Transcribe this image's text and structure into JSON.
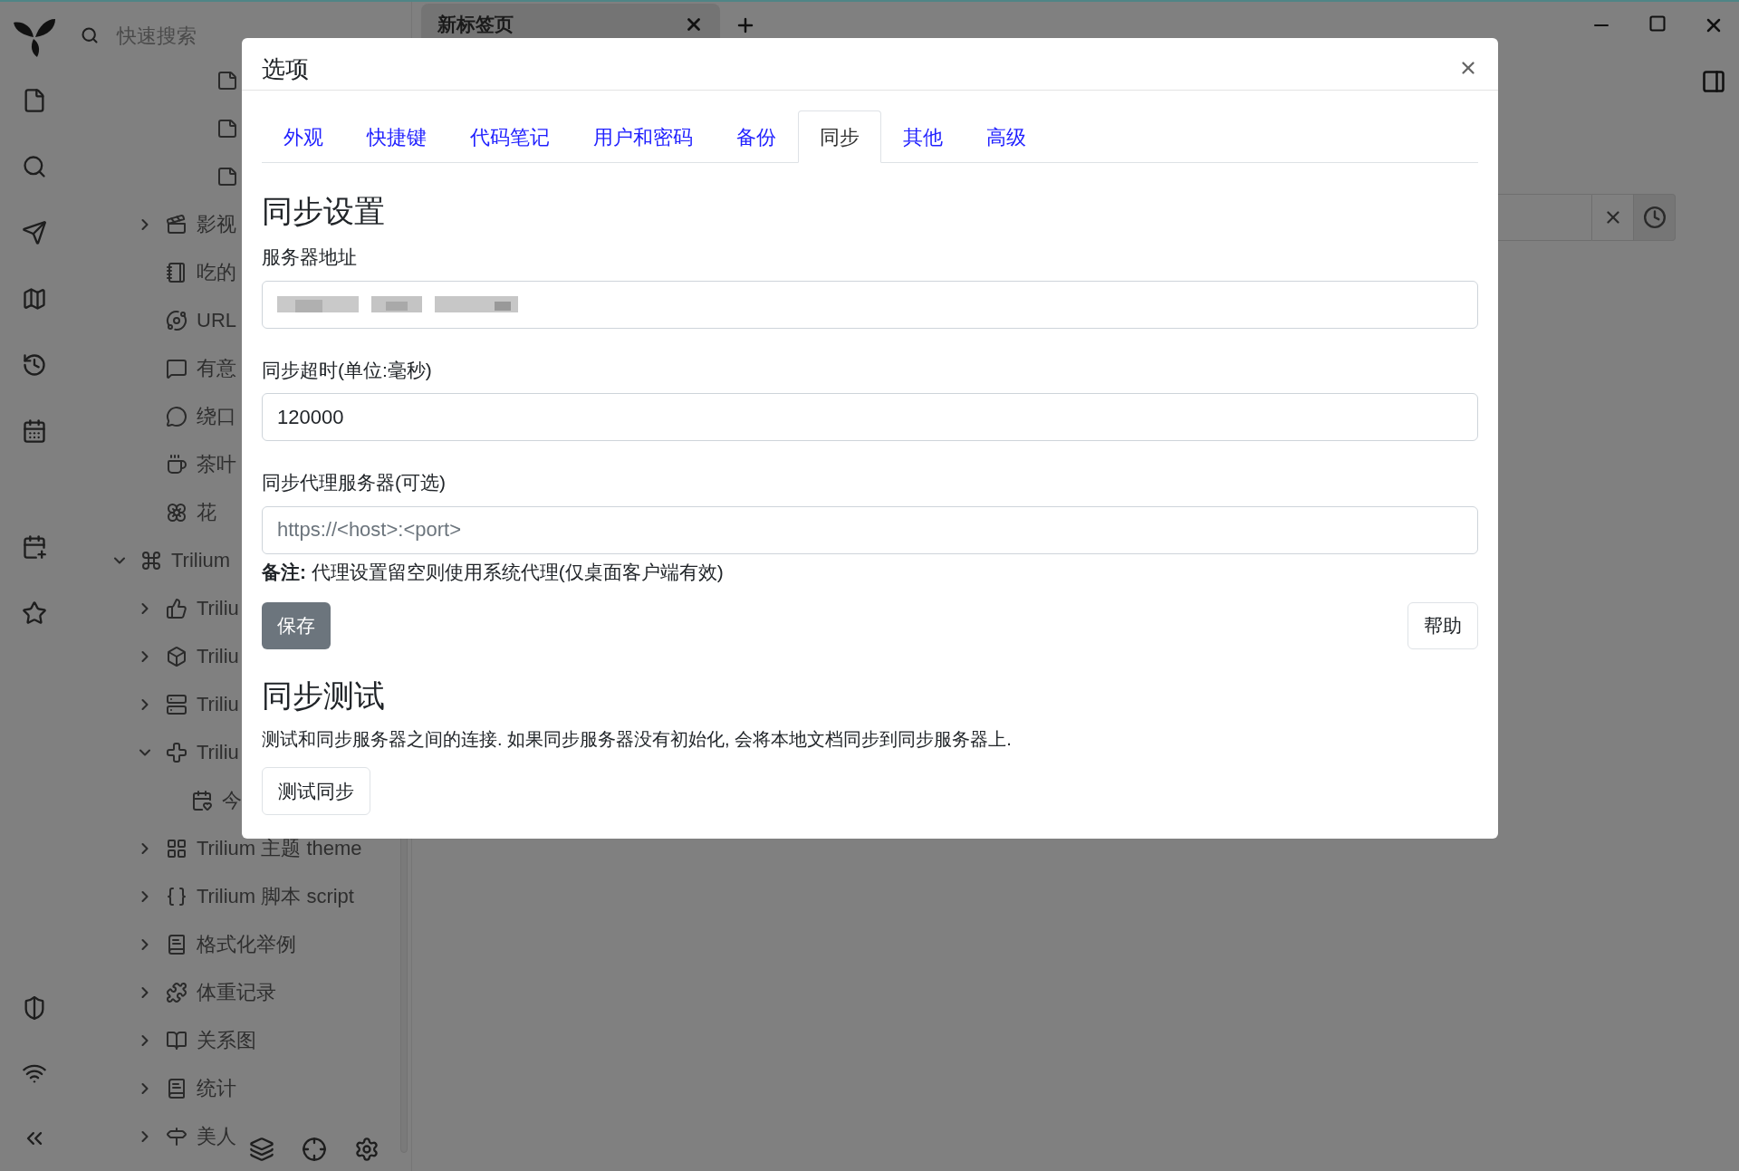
{
  "quick_search": {
    "placeholder": "快速搜索"
  },
  "tabs": [
    {
      "title": "新标签页",
      "selected": true
    }
  ],
  "tree": {
    "items": [
      {
        "kind": "continued",
        "children": [
          {
            "kind": "continued",
            "children": [
              {
                "kind": "continued",
                "children": [
                  {
                    "kind": "note"
                  },
                  {
                    "kind": "note"
                  },
                  {
                    "kind": "note"
                  }
                ]
              }
            ]
          },
          {
            "kind": "video",
            "title": "影视",
            "expanded": false
          },
          {
            "kind": "book",
            "title": "吃的"
          },
          {
            "kind": "link",
            "title": "URL"
          },
          {
            "kind": "comment",
            "title": "有意"
          },
          {
            "kind": "chat",
            "title": "绕口"
          },
          {
            "kind": "tea",
            "title": "茶叶"
          },
          {
            "kind": "flower",
            "title": "花"
          }
        ]
      },
      {
        "kind": "command",
        "title": "Trilium",
        "expanded": true,
        "children": [
          {
            "kind": "like",
            "title": "Triliu",
            "expanded": false
          },
          {
            "kind": "cube",
            "title": "Triliu",
            "expanded": false
          },
          {
            "kind": "server",
            "title": "Triliu",
            "expanded": false
          },
          {
            "kind": "plugin",
            "title": "Triliu",
            "expanded": true,
            "children": [
              {
                "kind": "calendar",
                "title": "今"
              }
            ]
          },
          {
            "kind": "layout",
            "title": "Trilium 主题 theme",
            "expanded": false
          },
          {
            "kind": "code",
            "title": "Trilium 脚本 script",
            "expanded": false
          },
          {
            "kind": "doc",
            "title": "格式化举例",
            "expanded": false
          },
          {
            "kind": "puzzle",
            "title": "体重记录",
            "expanded": false
          },
          {
            "kind": "map",
            "title": "关系图",
            "expanded": false
          },
          {
            "kind": "doc",
            "title": "统计",
            "expanded": false
          },
          {
            "kind": "sign",
            "title": "美人",
            "expanded": false
          }
        ]
      }
    ]
  },
  "dialog": {
    "title": "选项",
    "tabs": [
      {
        "label": "外观",
        "selected": false
      },
      {
        "label": "快捷键",
        "selected": false
      },
      {
        "label": "代码笔记",
        "selected": false
      },
      {
        "label": "用户和密码",
        "selected": false
      },
      {
        "label": "备份",
        "selected": false
      },
      {
        "label": "同步",
        "selected": true
      },
      {
        "label": "其他",
        "selected": false
      },
      {
        "label": "高级",
        "selected": false
      }
    ],
    "sync_settings": {
      "heading": "同步设置",
      "server_address": {
        "label": "服务器地址",
        "blurred": true
      },
      "timeout": {
        "label": "同步超时(单位:毫秒)",
        "value": "120000"
      },
      "proxy": {
        "label": "同步代理服务器(可选)",
        "placeholder": "https://<host>:<port>"
      },
      "note": "**备注:** 代理设置留空则使用系统代理(仅桌面客户端有效)",
      "save_button": "保存",
      "help_button": "帮助"
    },
    "sync_test": {
      "heading": "同步测试",
      "description": "测试和同步服务器之间的连接. 如果同步服务器没有初始化, 会将本地文档同步到同步服务器上.",
      "button": "测试同步"
    }
  }
}
